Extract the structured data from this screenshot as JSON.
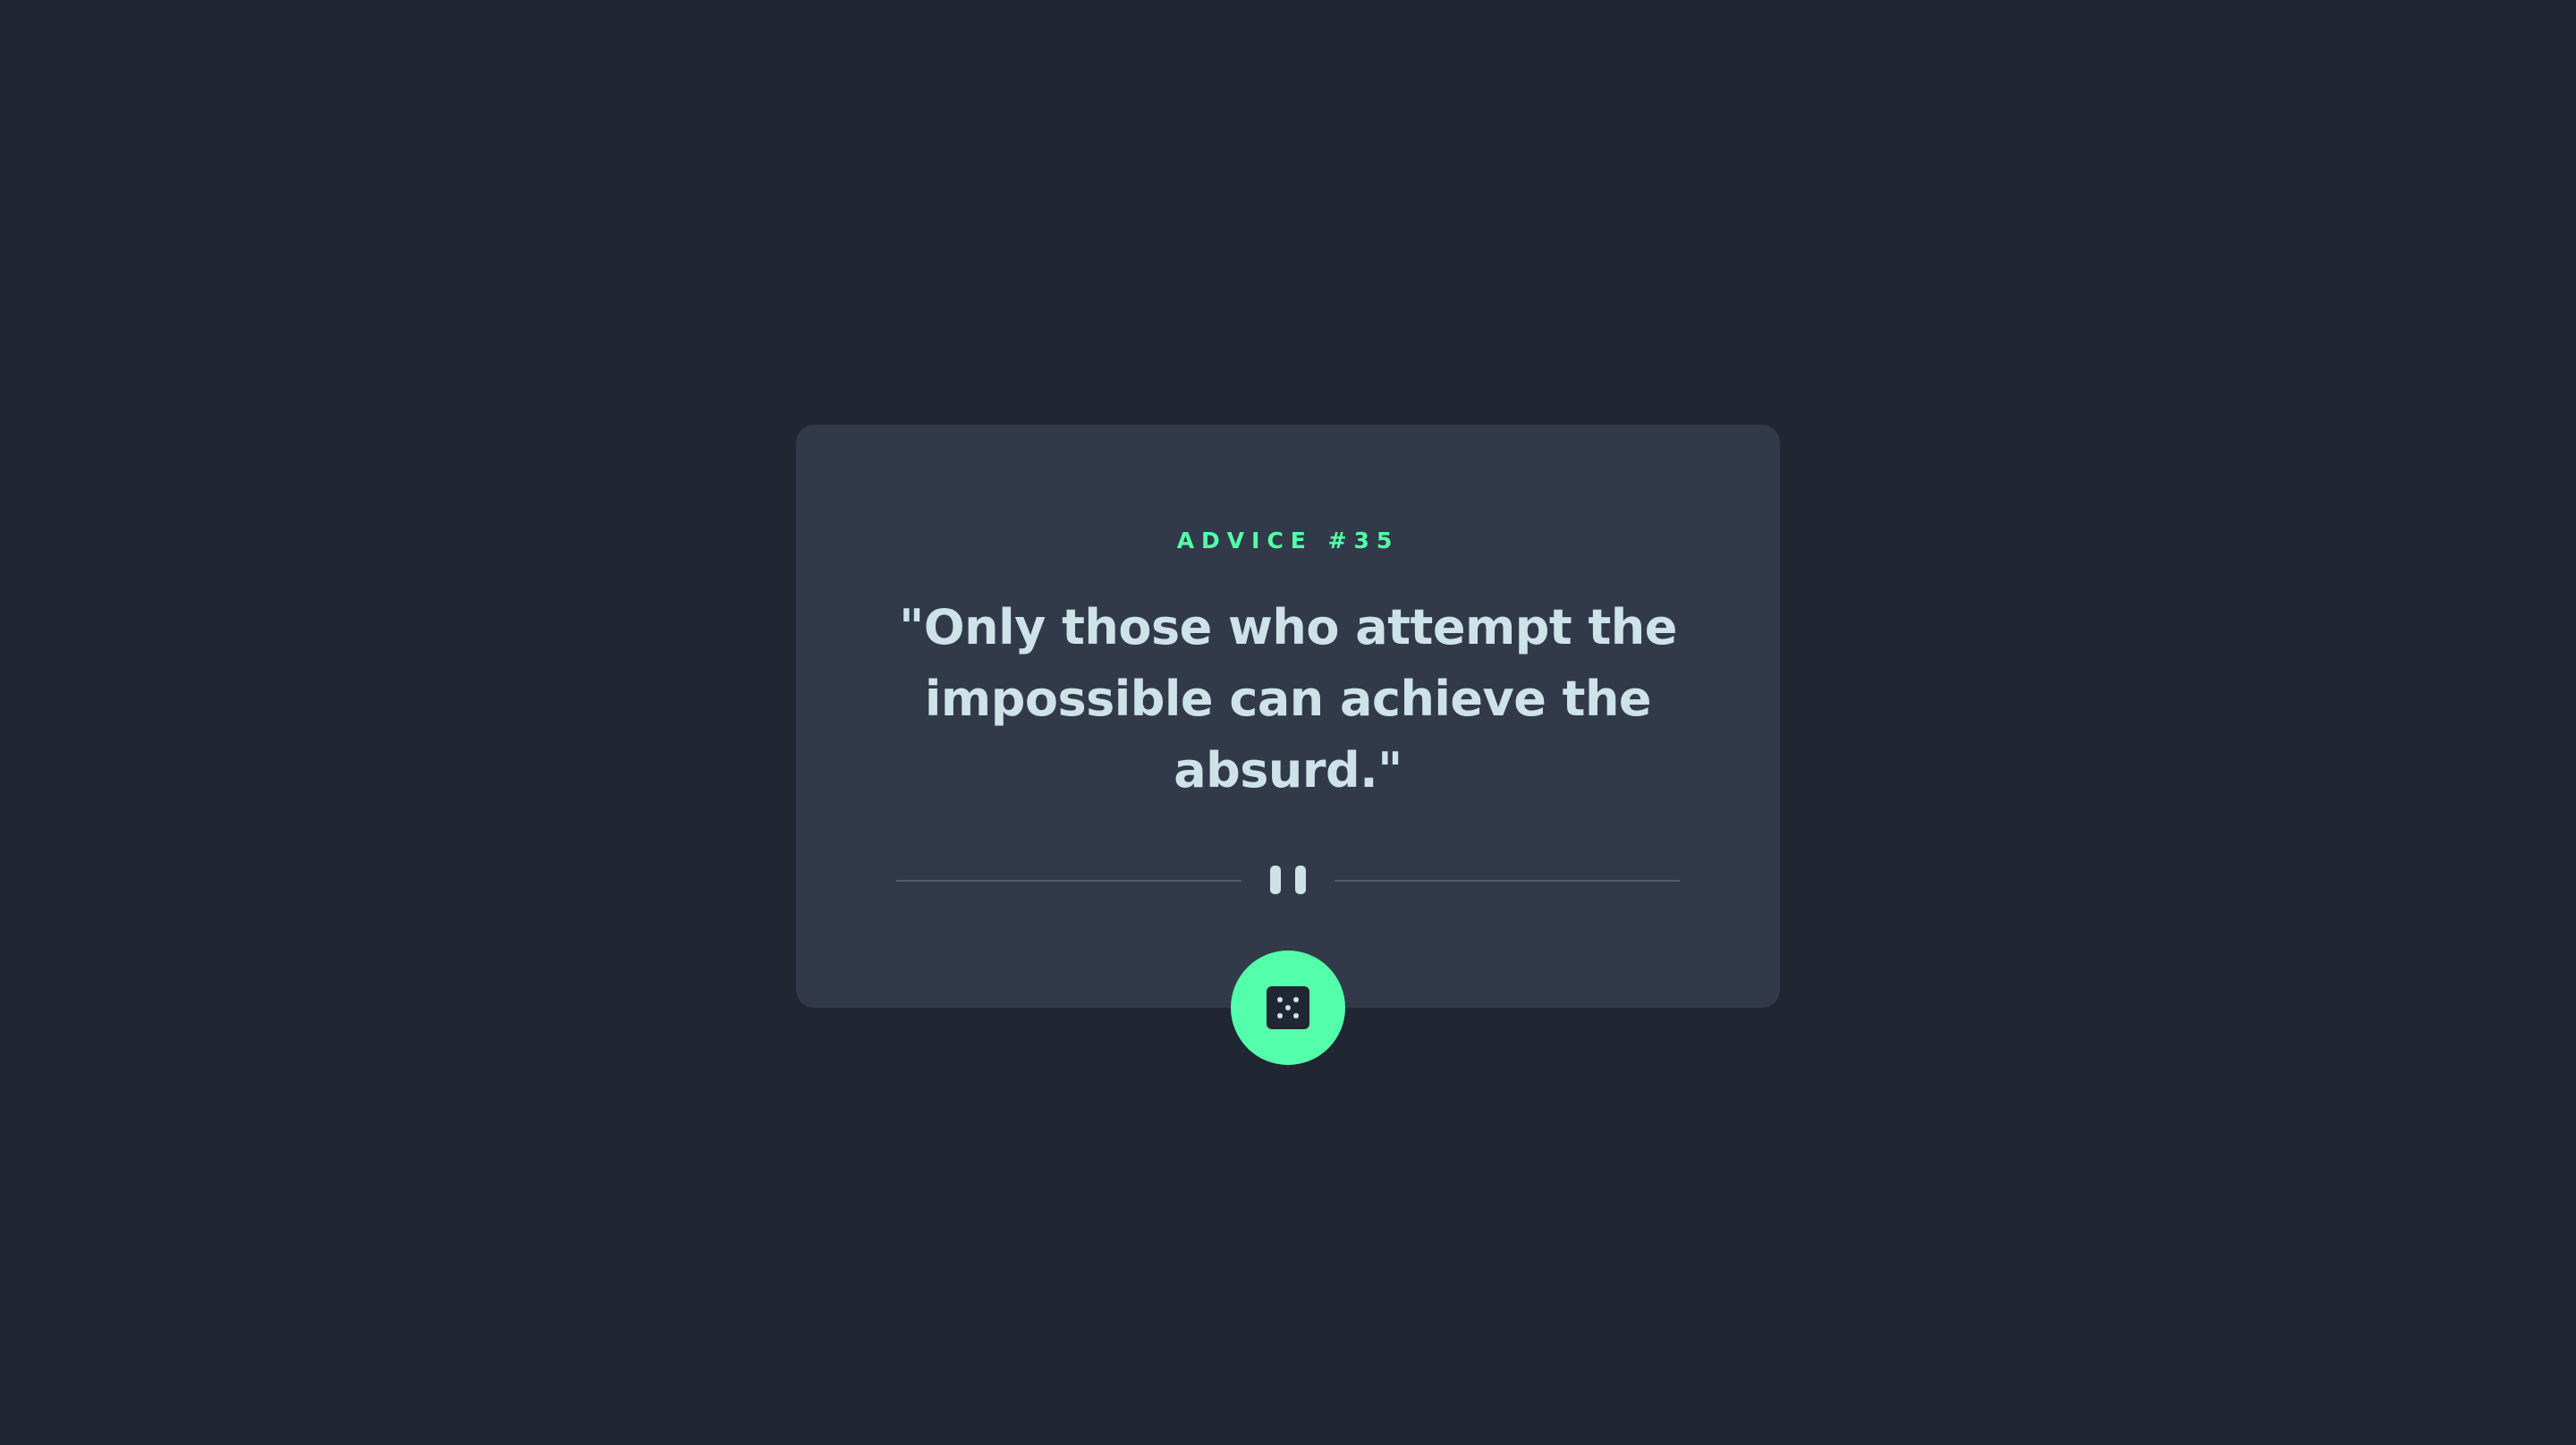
{
  "advice": {
    "label": "ADVICE #35",
    "quote": "\"Only those who attempt the impossible can achieve the absurd.\""
  },
  "icons": {
    "divider": "pause-icon",
    "button": "dice-icon"
  },
  "colors": {
    "background": "#202632",
    "card": "#323a49",
    "accent": "#53ffaa",
    "text": "#cee3e9",
    "divider": "#4f5d74"
  }
}
